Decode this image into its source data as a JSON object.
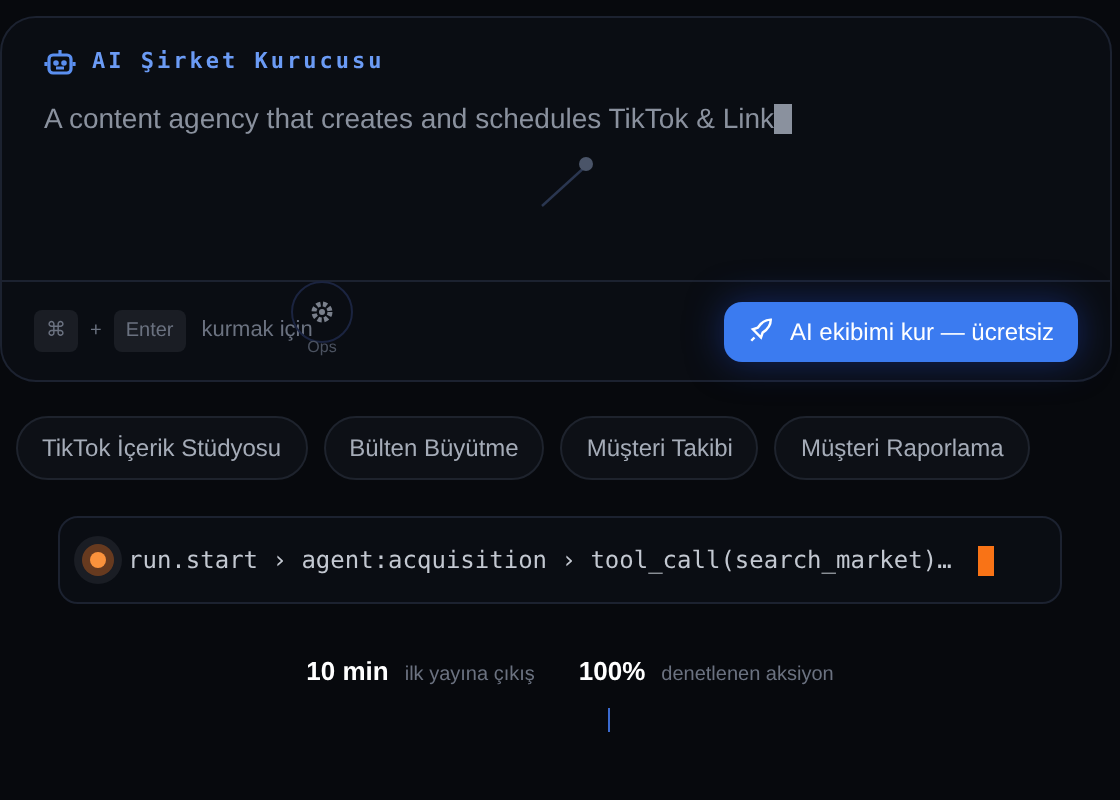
{
  "composer": {
    "title": "AI Şirket Kurucusu",
    "prompt": "A content agency that creates and schedules TikTok & Link",
    "hint": {
      "keys": [
        "⌘",
        "Enter"
      ],
      "joiner": "+",
      "text": "kurmak için"
    },
    "node": {
      "label": "Ops"
    },
    "submit": "AI ekibimi kur — ücretsiz"
  },
  "templates": [
    {
      "label": "TikTok İçerik Stüdyosu"
    },
    {
      "label": "Bülten Büyütme"
    },
    {
      "label": "Müşteri Takibi"
    },
    {
      "label": "Müşteri Raporlama"
    }
  ],
  "trace": {
    "steps": [
      "run.start",
      "agent:acquisition",
      "tool_call(search_market)…"
    ],
    "separator": "›"
  },
  "stats": [
    {
      "value": "10 min",
      "label": "ilk yayına çıkış"
    },
    {
      "value": "100%",
      "label": "denetlenen aksiyon"
    }
  ]
}
